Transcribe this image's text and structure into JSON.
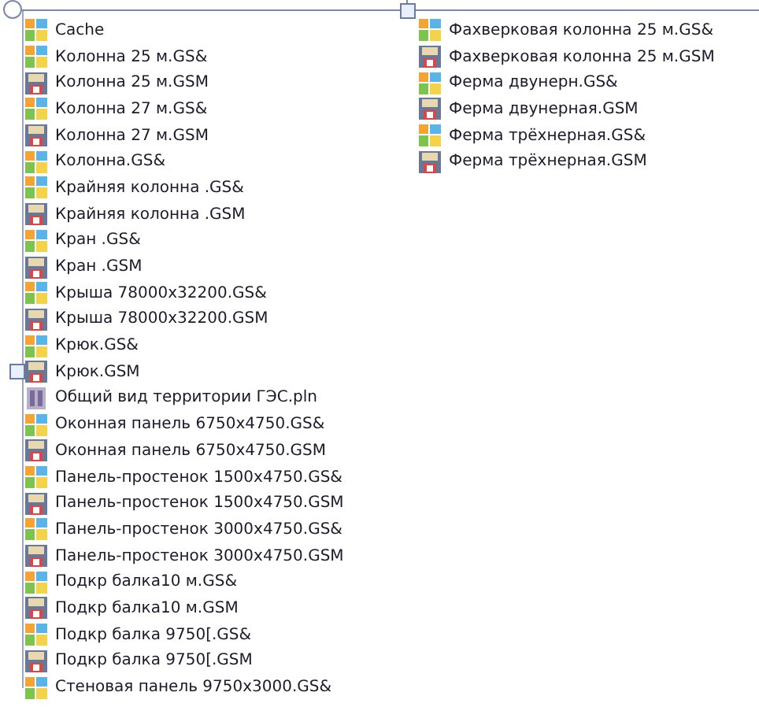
{
  "columns": [
    {
      "items": [
        {
          "kind": "folder",
          "name": "Cache"
        },
        {
          "kind": "gsx",
          "name": "Колонна 25 м.GS&"
        },
        {
          "kind": "gsm",
          "name": "Колонна 25 м.GSM"
        },
        {
          "kind": "gsx",
          "name": "Колонна 27 м.GS&"
        },
        {
          "kind": "gsm",
          "name": "Колонна 27 м.GSM"
        },
        {
          "kind": "gsx",
          "name": "Колонна.GS&"
        },
        {
          "kind": "gsx",
          "name": "Крайняя колонна .GS&"
        },
        {
          "kind": "gsm",
          "name": "Крайняя колонна .GSM"
        },
        {
          "kind": "gsx",
          "name": "Кран .GS&"
        },
        {
          "kind": "gsm",
          "name": "Кран .GSM"
        },
        {
          "kind": "gsx",
          "name": "Крыша 78000x32200.GS&"
        },
        {
          "kind": "gsm",
          "name": "Крыша 78000x32200.GSM"
        },
        {
          "kind": "gsx",
          "name": "Крюк.GS&"
        },
        {
          "kind": "gsm",
          "name": "Крюк.GSM"
        },
        {
          "kind": "pln",
          "name": "Общий вид территории ГЭС.pln"
        },
        {
          "kind": "gsx",
          "name": "Оконная панель 6750x4750.GS&"
        },
        {
          "kind": "gsm",
          "name": "Оконная панель 6750x4750.GSM"
        },
        {
          "kind": "gsx",
          "name": "Панель-простенок 1500x4750.GS&"
        },
        {
          "kind": "gsm",
          "name": "Панель-простенок 1500x4750.GSM"
        },
        {
          "kind": "gsx",
          "name": "Панель-простенок 3000x4750.GS&"
        },
        {
          "kind": "gsm",
          "name": "Панель-простенок 3000x4750.GSM"
        },
        {
          "kind": "gsx",
          "name": "Подкр балка10 м.GS&"
        },
        {
          "kind": "gsm",
          "name": "Подкр балка10 м.GSM"
        },
        {
          "kind": "gsx",
          "name": "Подкр балка 9750[.GS&"
        },
        {
          "kind": "gsm",
          "name": "Подкр балка 9750[.GSM"
        },
        {
          "kind": "gsx",
          "name": "Стеновая панель 9750x3000.GS&"
        }
      ]
    },
    {
      "items": [
        {
          "kind": "gsx",
          "name": "Фахверковая колонна 25 м.GS&"
        },
        {
          "kind": "gsm",
          "name": "Фахверковая колонна 25 м.GSM"
        },
        {
          "kind": "gsx",
          "name": "Ферма двунерн.GS&"
        },
        {
          "kind": "gsm",
          "name": "Ферма двунерная.GSM"
        },
        {
          "kind": "gsx",
          "name": "Ферма трёхнерная.GS&"
        },
        {
          "kind": "gsm",
          "name": "Ферма трёхнерная.GSM"
        }
      ]
    }
  ]
}
